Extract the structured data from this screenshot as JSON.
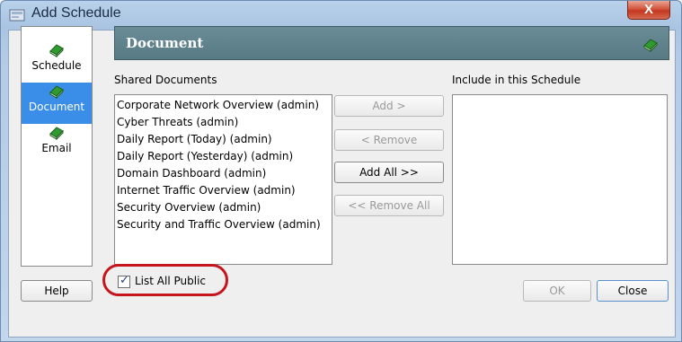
{
  "window": {
    "title": "Add Schedule",
    "close_glyph": "X"
  },
  "nav": {
    "items": [
      {
        "label": "Schedule",
        "icon": "book-icon",
        "selected": false
      },
      {
        "label": "Document",
        "icon": "book-icon",
        "selected": true
      },
      {
        "label": "Email",
        "icon": "book-icon",
        "selected": false
      }
    ]
  },
  "header": {
    "title": "Document",
    "icon": "book-icon"
  },
  "shared": {
    "caption": "Shared Documents",
    "items": [
      "Corporate Network Overview (admin)",
      "Cyber Threats (admin)",
      "Daily Report (Today) (admin)",
      "Daily Report (Yesterday) (admin)",
      "Domain Dashboard (admin)",
      "Internet Traffic Overview (admin)",
      "Security Overview (admin)",
      "Security and Traffic Overview (admin)"
    ]
  },
  "include": {
    "caption": "Include in this Schedule",
    "items": []
  },
  "buttons": {
    "add": "Add >",
    "remove": "< Remove",
    "add_all": "Add All >>",
    "remove_all": "<< Remove All",
    "help": "Help",
    "ok": "OK",
    "close": "Close"
  },
  "list_all_public": {
    "label": "List All Public",
    "checked": true
  },
  "colors": {
    "accent": "#c4161c",
    "header_bg": "#577a84",
    "selection": "#3a8ee8",
    "book_green": "#2f9a2f"
  }
}
